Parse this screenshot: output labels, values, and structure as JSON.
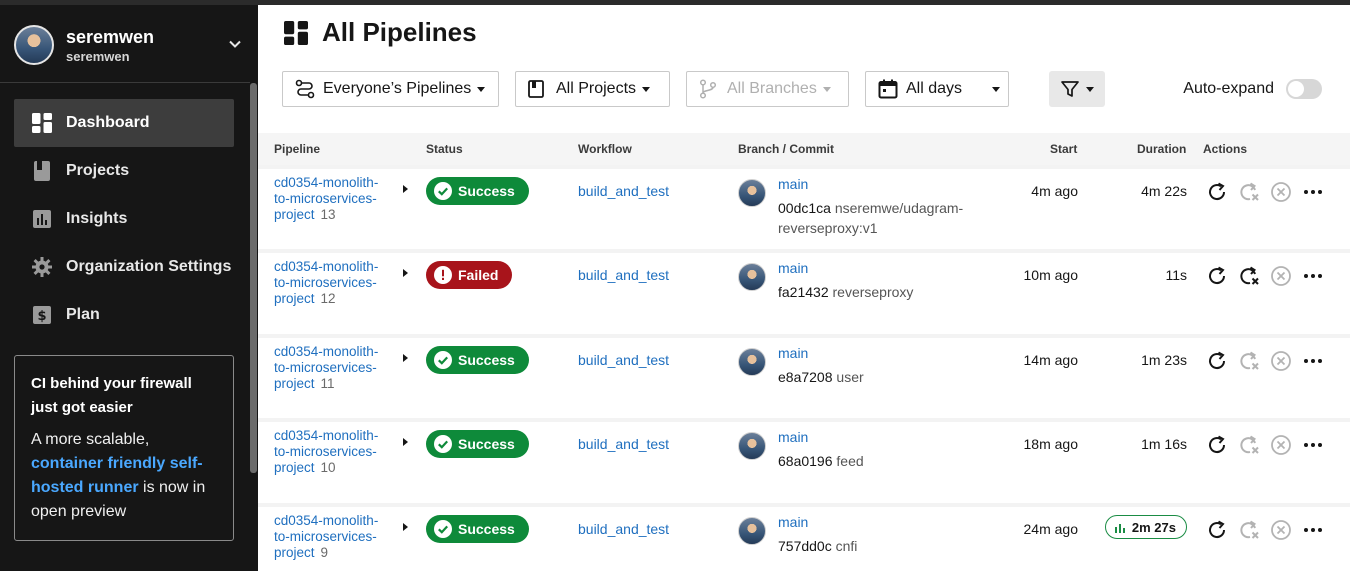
{
  "user": {
    "name": "seremwen",
    "org": "seremwen"
  },
  "sidebar": {
    "items": [
      {
        "label": "Dashboard",
        "icon": "dashboard-icon",
        "active": true
      },
      {
        "label": "Projects",
        "icon": "book-icon"
      },
      {
        "label": "Insights",
        "icon": "bar-chart-icon"
      },
      {
        "label": "Organization Settings",
        "icon": "gear-icon"
      },
      {
        "label": "Plan",
        "icon": "dollar-icon"
      }
    ],
    "promo": {
      "title": "CI behind your firewall just got easier",
      "body_prefix": "A more scalable, ",
      "link": "container friendly self-hosted runner",
      "body_suffix": " is now in open preview"
    }
  },
  "page": {
    "title": "All Pipelines"
  },
  "filters": {
    "pipelines": "Everyone’s Pipelines",
    "projects": "All Projects",
    "branches": "All Branches",
    "days": "All days",
    "auto_expand": "Auto-expand",
    "auto_expand_on": false
  },
  "table": {
    "headers": {
      "pipeline": "Pipeline",
      "status": "Status",
      "workflow": "Workflow",
      "branch_commit": "Branch / Commit",
      "start": "Start",
      "duration": "Duration",
      "actions": "Actions"
    },
    "rows": [
      {
        "project": "cd0354-monolith-to-microservices-project",
        "number": "13",
        "status": "Success",
        "workflow": "build_and_test",
        "branch": "main",
        "commit": "00dc1ca",
        "message": "nseremwe/udagram-reverseproxy:v1",
        "start": "4m ago",
        "duration": "4m 22s"
      },
      {
        "project": "cd0354-monolith-to-microservices-project",
        "number": "12",
        "status": "Failed",
        "workflow": "build_and_test",
        "branch": "main",
        "commit": "fa21432",
        "message": "reverseproxy",
        "start": "10m ago",
        "duration": "11s"
      },
      {
        "project": "cd0354-monolith-to-microservices-project",
        "number": "11",
        "status": "Success",
        "workflow": "build_and_test",
        "branch": "main",
        "commit": "e8a7208",
        "message": "user",
        "start": "14m ago",
        "duration": "1m 23s"
      },
      {
        "project": "cd0354-monolith-to-microservices-project",
        "number": "10",
        "status": "Success",
        "workflow": "build_and_test",
        "branch": "main",
        "commit": "68a0196",
        "message": "feed",
        "start": "18m ago",
        "duration": "1m 16s"
      },
      {
        "project": "cd0354-monolith-to-microservices-project",
        "number": "9",
        "status": "Success",
        "workflow": "build_and_test",
        "branch": "main",
        "commit": "757dd0c",
        "message": "cnfi",
        "start": "24m ago",
        "duration": "2m 27s"
      }
    ]
  },
  "colors": {
    "success": "#0e8a3a",
    "failed": "#a8141b",
    "link": "#1f6fbf",
    "sidebar_bg": "#161616"
  }
}
